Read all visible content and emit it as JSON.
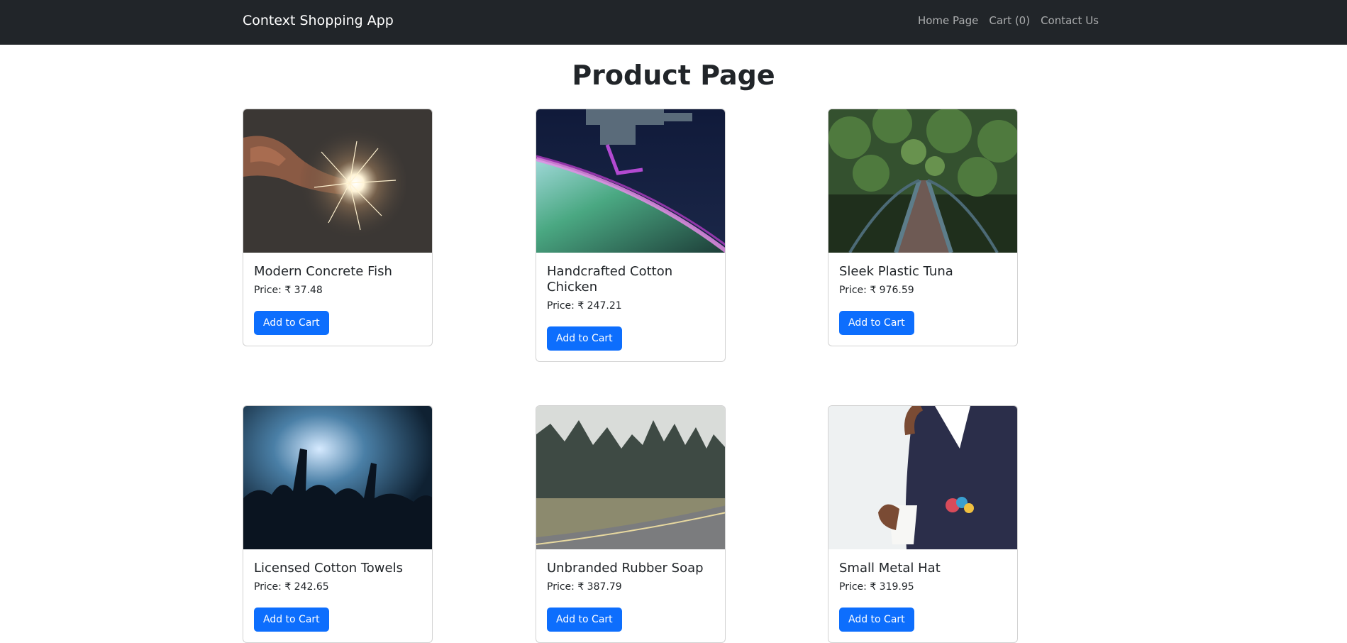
{
  "navbar": {
    "brand": "Context Shopping App",
    "links": [
      "Home Page",
      "Cart (0)",
      "Contact Us"
    ]
  },
  "page": {
    "title": "Product Page"
  },
  "products": [
    {
      "name": "Modern Concrete Fish",
      "price": "Price: ₹ 37.48",
      "button": "Add to Cart",
      "image": "sparkler-photo"
    },
    {
      "name": "Handcrafted Cotton Chicken",
      "price": "Price: ₹ 247.21",
      "button": "Add to Cart",
      "image": "space-station-aurora-photo"
    },
    {
      "name": "Sleek Plastic Tuna",
      "price": "Price: ₹ 976.59",
      "button": "Add to Cart",
      "image": "forest-bridge-photo"
    },
    {
      "name": "Licensed Cotton Towels",
      "price": "Price: ₹ 242.65",
      "button": "Add to Cart",
      "image": "concert-crowd-photo"
    },
    {
      "name": "Unbranded Rubber Soap",
      "price": "Price: ₹ 387.79",
      "button": "Add to Cart",
      "image": "forest-road-photo"
    },
    {
      "name": "Small Metal Hat",
      "price": "Price: ₹ 319.95",
      "button": "Add to Cart",
      "image": "man-suit-coffee-photo"
    }
  ],
  "colors": {
    "navbar_bg": "#212529",
    "primary_button": "#0d6efd",
    "text": "#212529"
  }
}
